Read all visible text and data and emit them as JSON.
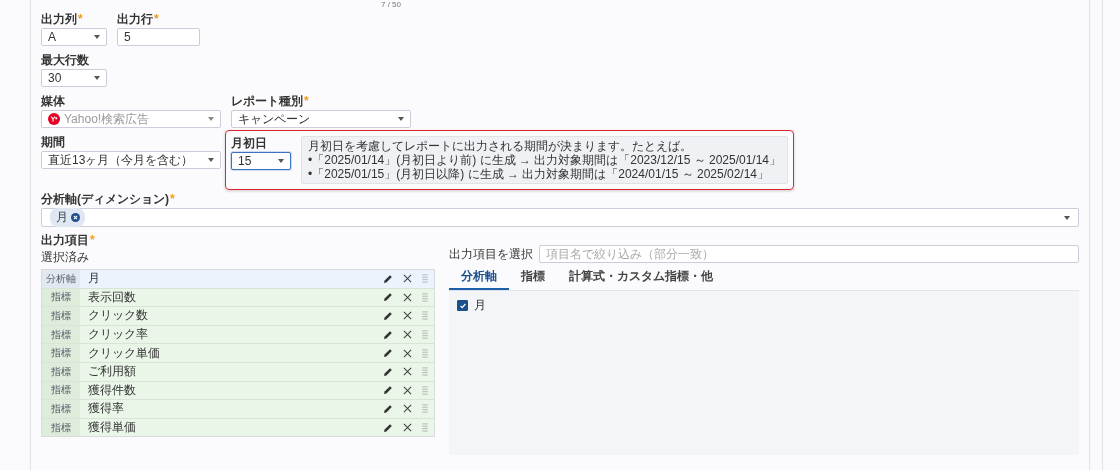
{
  "counter": "7 / 50",
  "output_column": {
    "label": "出力列",
    "mark": "*",
    "value": "A"
  },
  "output_row": {
    "label": "出力行",
    "mark": "*",
    "value": "5"
  },
  "max_rows": {
    "label": "最大行数",
    "value": "30"
  },
  "media": {
    "label": "媒体",
    "value": "Yahoo!検索広告",
    "disabled": true
  },
  "report_type": {
    "label": "レポート種別",
    "mark": "*",
    "value": "キャンペーン",
    "disabled": false
  },
  "period": {
    "label": "期間",
    "value": "直近13ヶ月（今月を含む）"
  },
  "month_start_day": {
    "label": "月初日",
    "value": "15",
    "focused": true,
    "highlighted": true,
    "help": [
      "月初日を考慮してレポートに出力される期間が決まります。たとえば。",
      "•「2025/01/14」(月初日より前) に生成 → 出力対象期間は「2023/12/15 ～ 2025/01/14」",
      "•「2025/01/15」(月初日以降) に生成 → 出力対象期間は「2024/01/15 ～ 2025/02/14」"
    ]
  },
  "dimension": {
    "label": "分析軸(ディメンション)",
    "mark": "*",
    "chips": [
      "月"
    ]
  },
  "output_items": {
    "label": "出力項目",
    "mark": "*",
    "selected_label": "選択済み",
    "rows": [
      {
        "kind": "dimension",
        "type_label": "分析軸",
        "name": "月"
      },
      {
        "kind": "metric",
        "type_label": "指標",
        "name": "表示回数"
      },
      {
        "kind": "metric",
        "type_label": "指標",
        "name": "クリック数"
      },
      {
        "kind": "metric",
        "type_label": "指標",
        "name": "クリック率"
      },
      {
        "kind": "metric",
        "type_label": "指標",
        "name": "クリック単価"
      },
      {
        "kind": "metric",
        "type_label": "指標",
        "name": "ご利用額"
      },
      {
        "kind": "metric",
        "type_label": "指標",
        "name": "獲得件数"
      },
      {
        "kind": "metric",
        "type_label": "指標",
        "name": "獲得率"
      },
      {
        "kind": "metric",
        "type_label": "指標",
        "name": "獲得単価"
      }
    ]
  },
  "picker": {
    "label": "出力項目を選択",
    "placeholder": "項目名で絞り込み（部分一致）",
    "tabs": [
      {
        "label": "分析軸",
        "selected": true
      },
      {
        "label": "指標",
        "selected": false
      },
      {
        "label": "計算式・カスタム指標・他",
        "selected": false
      }
    ],
    "options": [
      {
        "label": "月",
        "checked": true
      }
    ]
  }
}
